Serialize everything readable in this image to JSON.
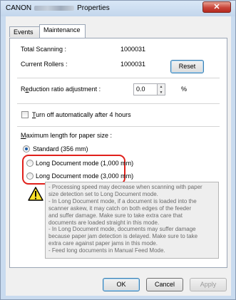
{
  "window": {
    "title_prefix": "CANON",
    "title_suffix": "Properties",
    "close_glyph": "✕"
  },
  "tabs": [
    {
      "label": "Events",
      "active": false
    },
    {
      "label": "Maintenance",
      "active": true
    }
  ],
  "counters": {
    "total_scanning_label": "Total Scanning :",
    "total_scanning_value": "1000031",
    "current_rollers_label": "Current Rollers :",
    "current_rollers_value": "1000031",
    "reset_label": "Reset"
  },
  "reduction": {
    "label_pre": "R",
    "label_accel": "e",
    "label_post": "duction ratio adjustment :",
    "value": "0.0",
    "unit": "%"
  },
  "auto_off": {
    "accel": "T",
    "label_rest": "urn off automatically after 4 hours",
    "checked": false
  },
  "paper_length": {
    "label_accel": "M",
    "label_rest": "aximum length for paper size :",
    "options": [
      {
        "label": "Standard (356 mm)",
        "checked": true
      },
      {
        "label": "Long Document mode (1,000 mm)",
        "checked": false
      },
      {
        "label": "Long Document mode (3,000 mm)",
        "checked": false
      }
    ]
  },
  "warning": {
    "icon": "warning-triangle",
    "lines": [
      "- Processing speed may decrease when scanning with paper",
      "size detection set to Long Document mode.",
      "- In Long Document mode, if a document is loaded into the",
      "scanner askew, it may catch on both edges of the feeder",
      "and suffer damage. Make sure to take extra care that",
      "documents are loaded straight in this mode.",
      "- In Long Document mode, documents may suffer damage",
      "because paper jam detection is delayed. Make sure to take",
      "extra care against paper jams in this mode.",
      "- Feed long documents in Manual Feed Mode."
    ]
  },
  "footer": {
    "ok": "OK",
    "cancel": "Cancel",
    "apply": "Apply"
  },
  "colors": {
    "highlight": "#e0201b",
    "close_button": "#c9453a",
    "titlebar": "#c9dbef"
  }
}
